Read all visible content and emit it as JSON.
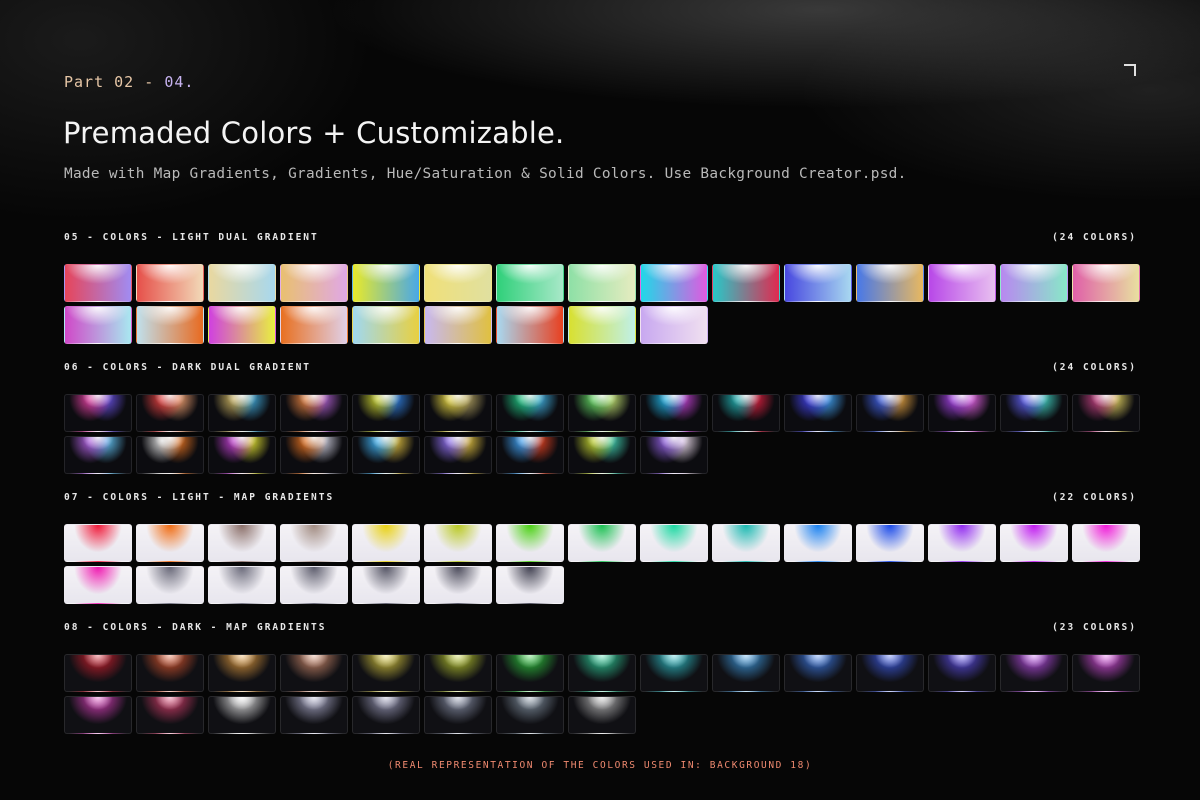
{
  "header": {
    "part_label": "Part 02 - ",
    "part_number": "04.",
    "title": "Premaded Colors + Customizable.",
    "subtitle": "Made with Map Gradients, Gradients, Hue/Saturation & Solid Colors. Use Background Creator.psd."
  },
  "sections": [
    {
      "title": "05 - COLORS - LIGHT DUAL GRADIENT",
      "count": "(24 COLORS)",
      "mode": "light-dual",
      "swatches": [
        [
          "#e6455a",
          "#a08cf2"
        ],
        [
          "#e6504a",
          "#f2d9b8"
        ],
        [
          "#e9d8a0",
          "#a8d8ee"
        ],
        [
          "#e9c070",
          "#e0a8e6"
        ],
        [
          "#e8e92a",
          "#48a8e8"
        ],
        [
          "#f0e078",
          "#e0e0a0"
        ],
        [
          "#2fd07a",
          "#a8e8c8"
        ],
        [
          "#8ee0a6",
          "#e6ecc0"
        ],
        [
          "#20d8e8",
          "#e05ae0"
        ],
        [
          "#28c8c8",
          "#e02a50"
        ],
        [
          "#4848e0",
          "#a8d8f0"
        ],
        [
          "#4878e8",
          "#e8b860"
        ],
        [
          "#b848e8",
          "#e8c0f0"
        ],
        [
          "#b888f0",
          "#88e8c8"
        ],
        [
          "#e060a8",
          "#e8e0a0"
        ],
        [
          "#d048c8",
          "#a8e8f0"
        ],
        [
          "#c0e0ec",
          "#e86a20"
        ],
        [
          "#d040e0",
          "#e8f040"
        ],
        [
          "#e87020",
          "#e0d0e8"
        ],
        [
          "#a0d8f0",
          "#e8d040"
        ],
        [
          "#c8b8f0",
          "#e0c040"
        ],
        [
          "#a8d8f0",
          "#e84020"
        ],
        [
          "#d8e030",
          "#c0f0e8"
        ],
        [
          "#c8a8f0",
          "#f0e0f0"
        ]
      ]
    },
    {
      "title": "06 - COLORS - DARK DUAL GRADIENT",
      "count": "(24 COLORS)",
      "mode": "dark-dual",
      "swatches": [
        [
          "#e040a0",
          "#6850e0"
        ],
        [
          "#e04040",
          "#f0a070"
        ],
        [
          "#c8b060",
          "#40a8d8"
        ],
        [
          "#e08040",
          "#b060d0"
        ],
        [
          "#c8d030",
          "#3080e0"
        ],
        [
          "#e0d040",
          "#b0a060"
        ],
        [
          "#20c080",
          "#40b0e0"
        ],
        [
          "#60d060",
          "#c0e070"
        ],
        [
          "#20b0e0",
          "#c040d0"
        ],
        [
          "#20b0b0",
          "#e02040"
        ],
        [
          "#4040e0",
          "#40a0f0"
        ],
        [
          "#4060e0",
          "#e0a040"
        ],
        [
          "#a040e0",
          "#e060e0"
        ],
        [
          "#6060f0",
          "#40d0c0"
        ],
        [
          "#c04080",
          "#e0d060"
        ],
        [
          "#b060e0",
          "#60c0f0"
        ],
        [
          "#e0e0e0",
          "#e07020"
        ],
        [
          "#c040d0",
          "#e0e030"
        ],
        [
          "#e07020",
          "#d0d0e0"
        ],
        [
          "#40b0f0",
          "#e0c040"
        ],
        [
          "#9070f0",
          "#e0c040"
        ],
        [
          "#40a0f0",
          "#e04020"
        ],
        [
          "#c0d030",
          "#40d0b0"
        ],
        [
          "#9060e0",
          "#f0e0f0"
        ]
      ]
    },
    {
      "title": "07 - COLORS - LIGHT - MAP GRADIENTS",
      "count": "(22 COLORS)",
      "mode": "light-map",
      "swatches": [
        "#f01838",
        "#f06a10",
        "#8a6e68",
        "#a08a80",
        "#e8d010",
        "#b8c820",
        "#48d010",
        "#18c050",
        "#18d8a0",
        "#18b8b0",
        "#1880f0",
        "#1848e8",
        "#9028f0",
        "#c018f0",
        "#f018d8",
        "#f018b0",
        "#686878",
        "#6a6a7a",
        "#5c5c6c",
        "#545464",
        "#4a4a5a",
        "#404050"
      ]
    },
    {
      "title": "08 - COLORS - DARK - MAP GRADIENTS",
      "count": "(23 COLORS)",
      "mode": "dark-map",
      "swatches": [
        "#d82030",
        "#e05830",
        "#e8a040",
        "#d89070",
        "#e0d040",
        "#c0d030",
        "#30d040",
        "#30d8a0",
        "#30c8d0",
        "#40a0e8",
        "#4080f0",
        "#4060f0",
        "#6050f0",
        "#c050f0",
        "#e050e8",
        "#e040c0",
        "#e04070",
        "#f0f0f0",
        "#b0b0d0",
        "#a0a0c0",
        "#9098b0",
        "#8898a8",
        "#c0c0c0"
      ]
    }
  ],
  "footer": "(REAL REPRESENTATION OF THE COLORS USED IN: BACKGROUND 18)"
}
